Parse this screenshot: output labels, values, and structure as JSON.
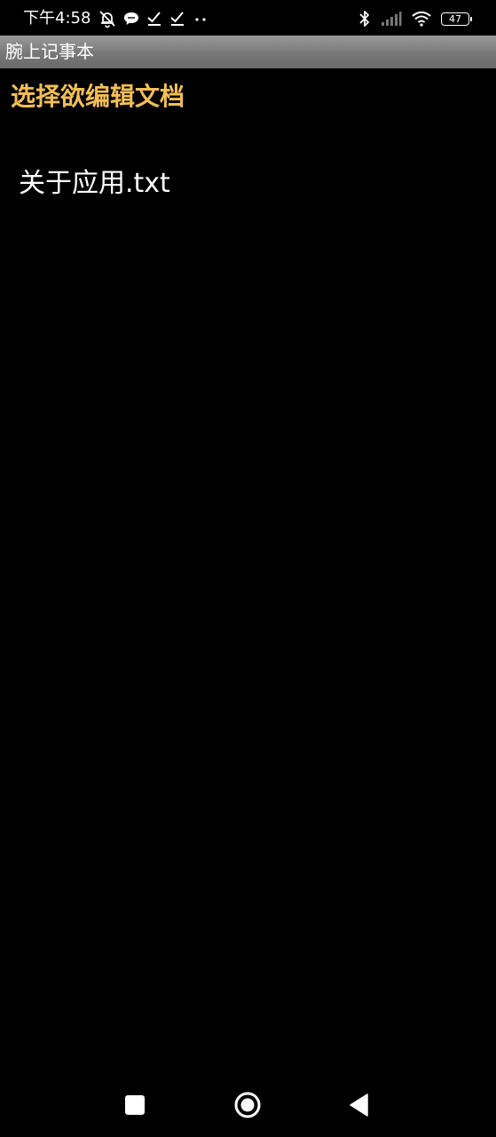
{
  "status_bar": {
    "time": "下午4:58",
    "battery_level": "47",
    "icons_left": [
      "mute-bell-icon",
      "chat-bubble-icon",
      "check-icon",
      "check-icon",
      "more-dots-icon"
    ],
    "icons_right": [
      "bluetooth-icon",
      "signal-icon",
      "wifi-icon",
      "battery-icon"
    ]
  },
  "title_bar": {
    "title": "腕上记事本"
  },
  "dialog": {
    "header": "选择欲编辑文档",
    "files": [
      "关于应用.txt"
    ]
  },
  "nav_bar": {
    "buttons": [
      "recents-button",
      "home-button",
      "back-button"
    ]
  },
  "colors": {
    "header_text": "#f3bf55",
    "background": "#000000",
    "title_bar": "#808080"
  }
}
